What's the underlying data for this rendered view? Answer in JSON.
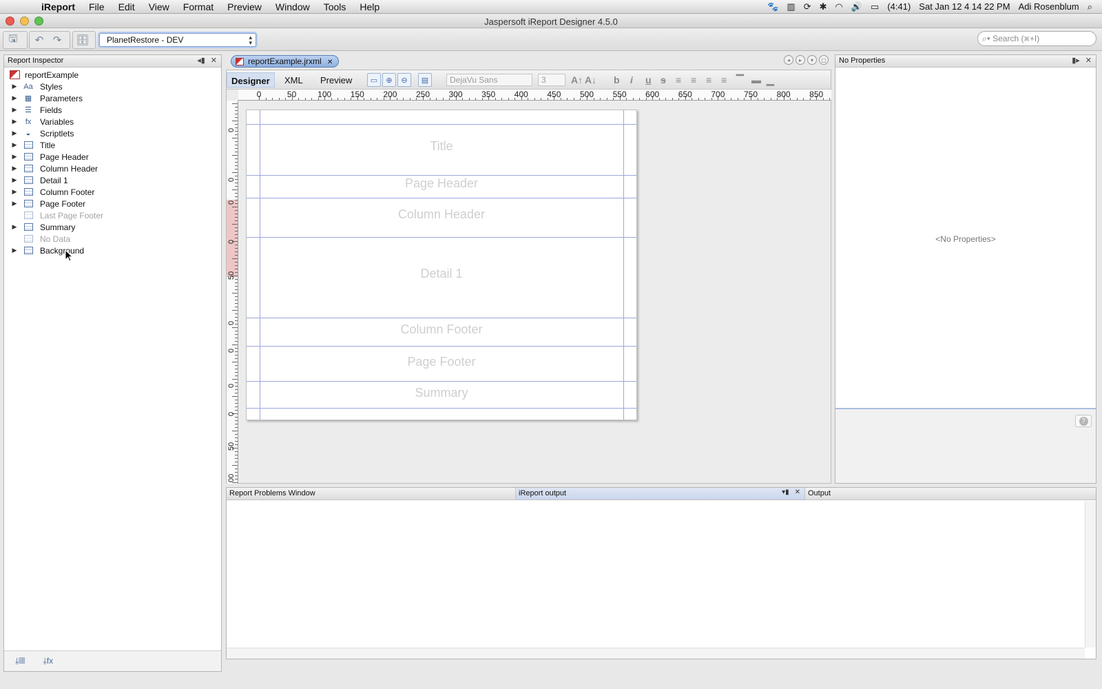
{
  "menubar": {
    "items": [
      "iReport",
      "File",
      "Edit",
      "View",
      "Format",
      "Preview",
      "Window",
      "Tools",
      "Help"
    ],
    "battery": "(4:41)",
    "clock": "Sat Jan 12  4 14 22 PM",
    "user": "Adi Rosenblum"
  },
  "window": {
    "title": "Jaspersoft iReport Designer 4.5.0"
  },
  "toolbar": {
    "datasource": "PlanetRestore - DEV",
    "search_placeholder": "Search (⌘+I)"
  },
  "inspector": {
    "title": "Report Inspector",
    "root": "reportExample",
    "items": [
      {
        "label": "Styles",
        "expandable": true,
        "icon": "styles-icon",
        "disabled": false
      },
      {
        "label": "Parameters",
        "expandable": true,
        "icon": "parameters-icon",
        "disabled": false
      },
      {
        "label": "Fields",
        "expandable": true,
        "icon": "fields-icon",
        "disabled": false
      },
      {
        "label": "Variables",
        "expandable": true,
        "icon": "variables-icon",
        "disabled": false
      },
      {
        "label": "Scriptlets",
        "expandable": true,
        "icon": "scriptlets-icon",
        "disabled": false
      },
      {
        "label": "Title",
        "expandable": true,
        "icon": "band-icon",
        "disabled": false
      },
      {
        "label": "Page Header",
        "expandable": true,
        "icon": "band-icon",
        "disabled": false
      },
      {
        "label": "Column Header",
        "expandable": true,
        "icon": "band-icon",
        "disabled": false
      },
      {
        "label": "Detail 1",
        "expandable": true,
        "icon": "band-icon",
        "disabled": false
      },
      {
        "label": "Column Footer",
        "expandable": true,
        "icon": "band-icon",
        "disabled": false
      },
      {
        "label": "Page Footer",
        "expandable": true,
        "icon": "band-icon",
        "disabled": false
      },
      {
        "label": "Last Page Footer",
        "expandable": false,
        "icon": "band-icon",
        "disabled": true
      },
      {
        "label": "Summary",
        "expandable": true,
        "icon": "band-icon",
        "disabled": false
      },
      {
        "label": "No Data",
        "expandable": false,
        "icon": "band-icon",
        "disabled": true
      },
      {
        "label": "Background",
        "expandable": true,
        "icon": "band-icon",
        "disabled": false
      }
    ]
  },
  "editor": {
    "tab_label": "reportExample.jrxml",
    "view_tabs": [
      "Designer",
      "XML",
      "Preview"
    ],
    "active_view": "Designer",
    "font_name": "DejaVu Sans",
    "font_size": "3",
    "ruler_labels": [
      "0",
      "50",
      "100",
      "150",
      "200",
      "250",
      "300",
      "350",
      "400",
      "450",
      "500",
      "550",
      "600",
      "650",
      "700",
      "750",
      "800",
      "850"
    ],
    "vruler_labels": [
      "0",
      "0",
      "0",
      "0",
      "50",
      "0",
      "0",
      "0",
      "0",
      "50",
      "00"
    ],
    "bands": [
      "Title",
      "Page Header",
      "Column Header",
      "Detail 1",
      "Column Footer",
      "Page Footer",
      "Summary"
    ]
  },
  "properties": {
    "title": "No Properties",
    "empty_text": "<No Properties>"
  },
  "output": {
    "tabs": [
      "Report Problems Window",
      "iReport output",
      "Output"
    ],
    "active_tab": "iReport output"
  },
  "colors": {
    "band_line": "#9aa6dc",
    "band_label": "#cfcfcf",
    "selection": "#b8cdef"
  }
}
